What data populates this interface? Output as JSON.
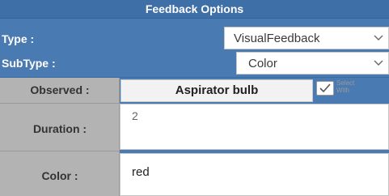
{
  "panel": {
    "title": "Feedback Options"
  },
  "type_row": {
    "label": "Type :",
    "value": "VisualFeedback"
  },
  "subtype_row": {
    "label": "SubType :",
    "value": "Color"
  },
  "observed_row": {
    "label": "Observed :",
    "value": "Aspirator bulb",
    "select_with_line1": "Select",
    "select_with_line2": "With",
    "checked": true
  },
  "duration_row": {
    "label": "Duration :",
    "value": "2"
  },
  "color_row": {
    "label": "Color :",
    "value": "red"
  },
  "colors": {
    "header_blue": "#3f6fa7",
    "panel_blue": "#4a7ab2",
    "label_gray": "#b3b3b3"
  }
}
